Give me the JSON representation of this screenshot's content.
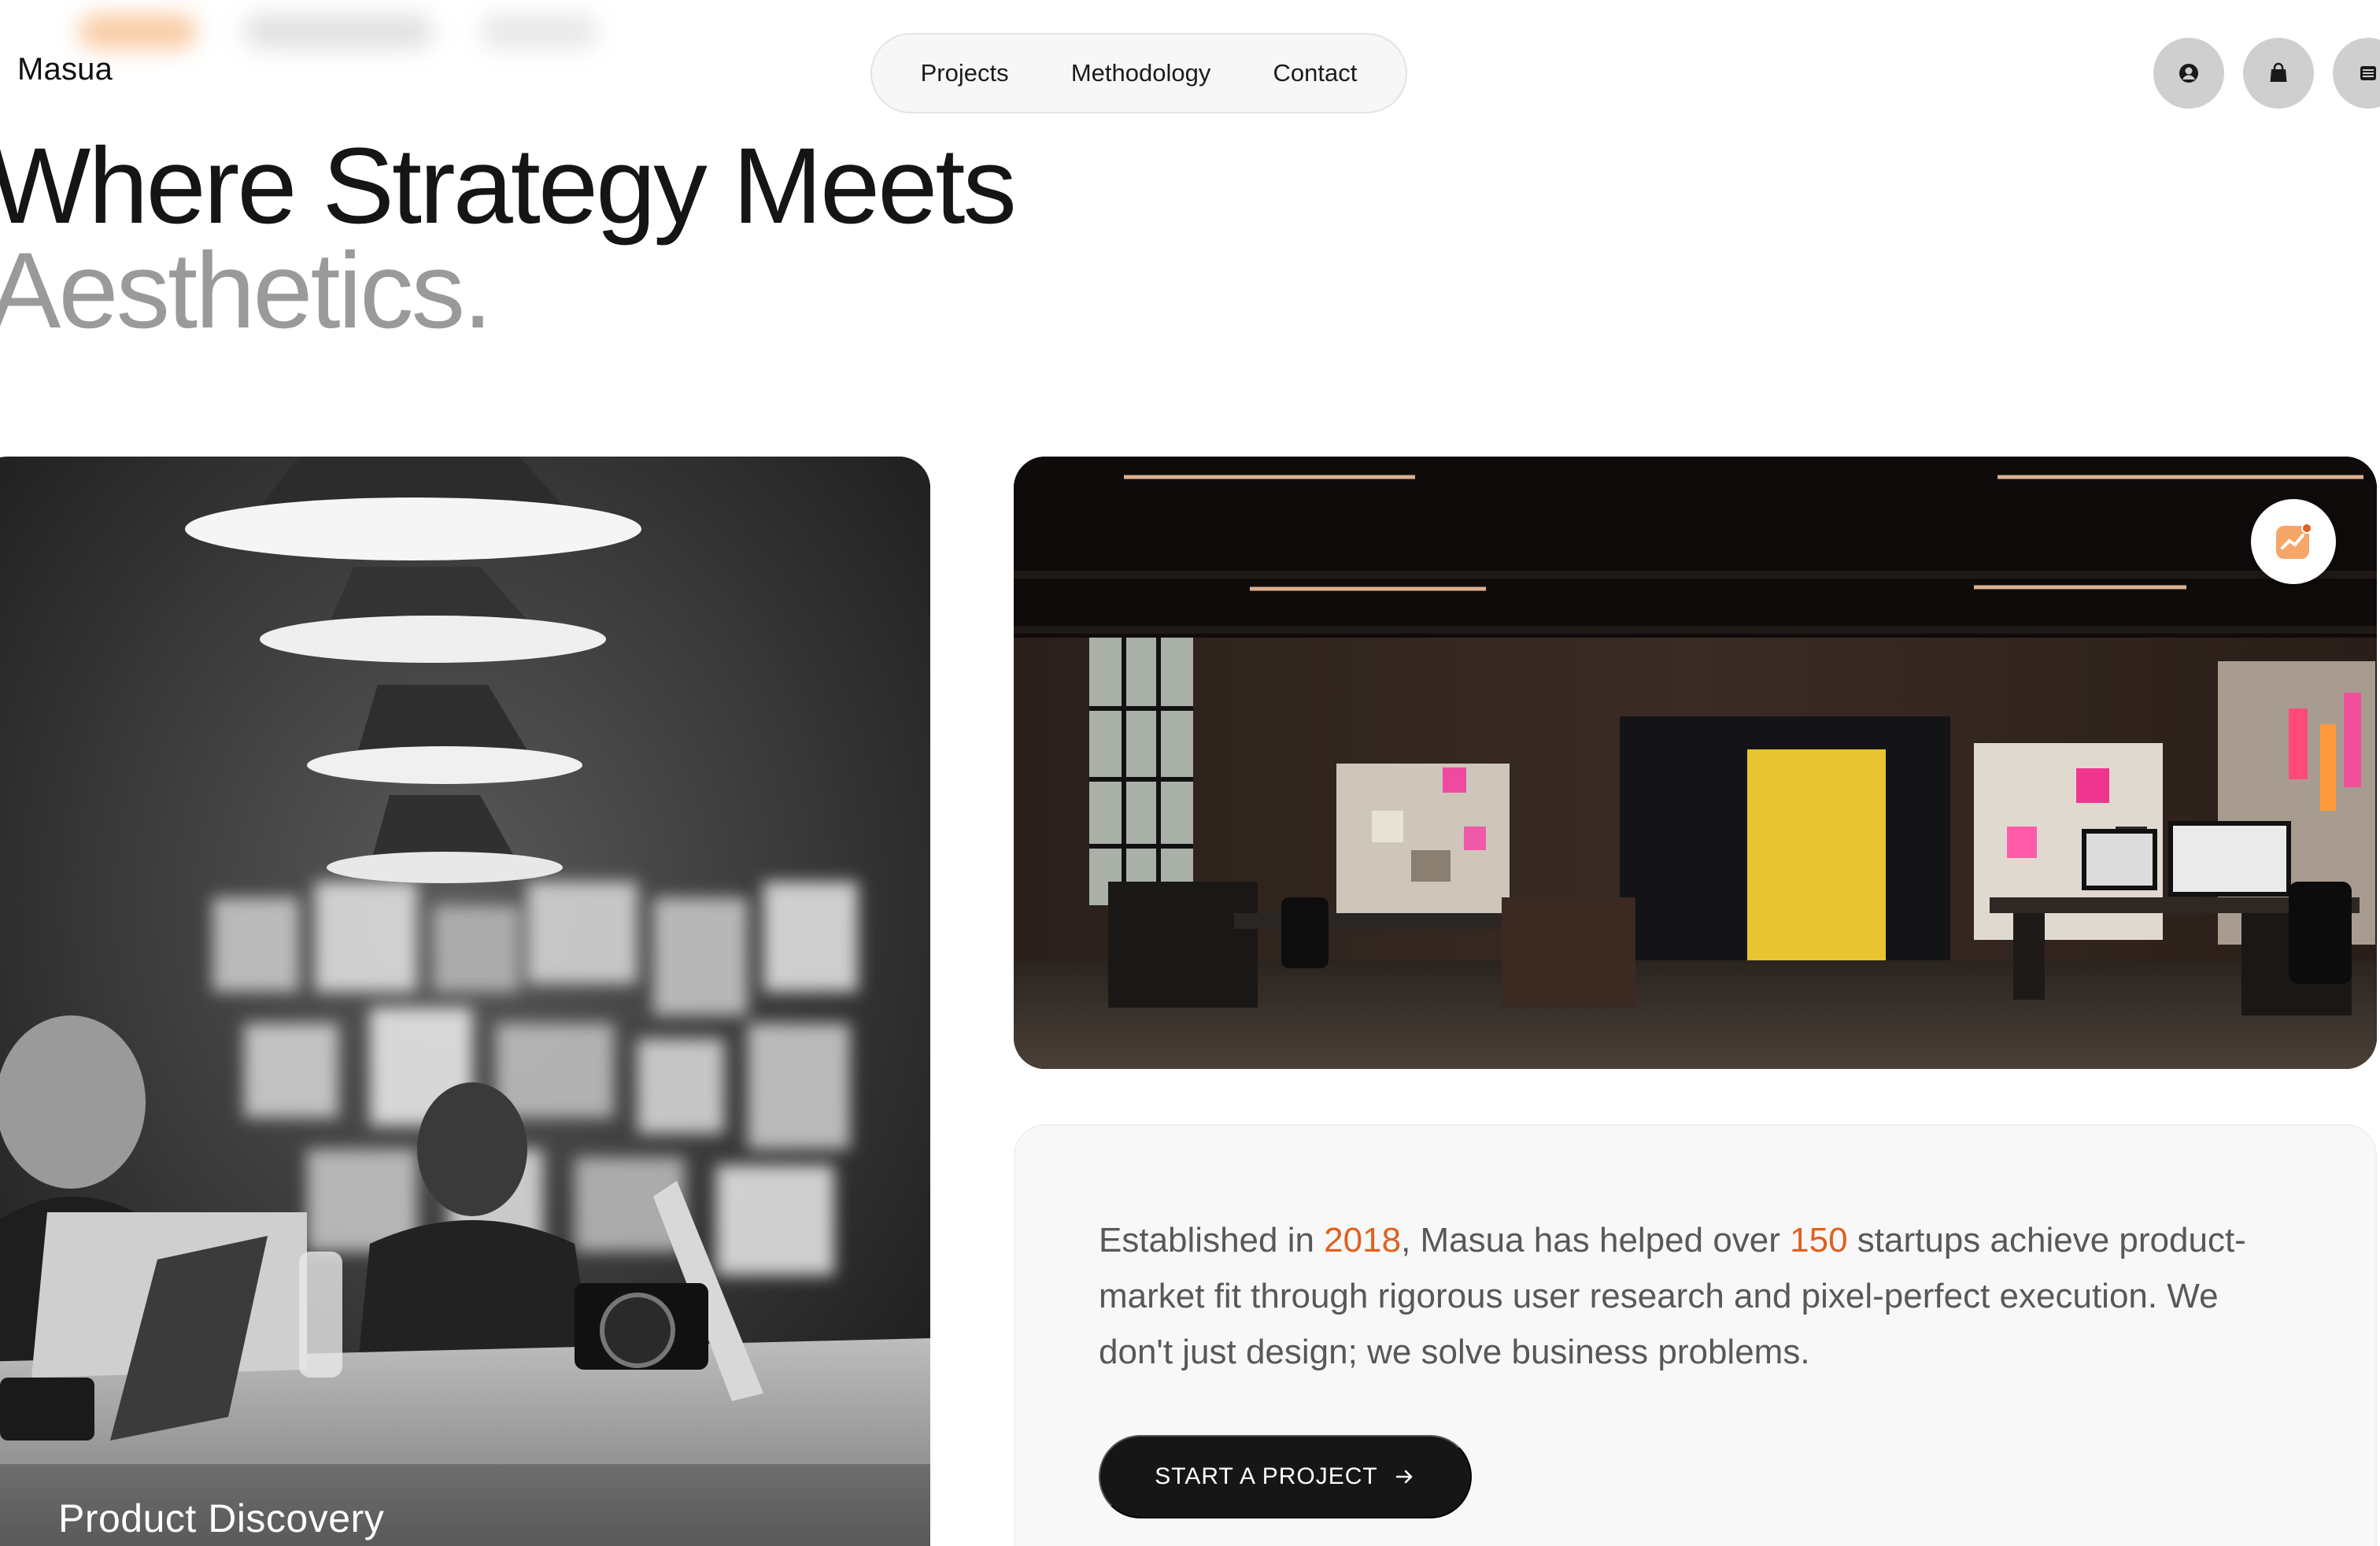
{
  "brand": {
    "name": "Masua",
    "accent": "#e0601e"
  },
  "nav": {
    "items": [
      {
        "label": "Projects"
      },
      {
        "label": "Methodology"
      },
      {
        "label": "Contact"
      }
    ]
  },
  "header_icons": [
    "user-icon",
    "bag-icon",
    "menu-icon"
  ],
  "hero": {
    "line1": "Where Strategy Meets",
    "line2": "Aesthetics."
  },
  "cards": {
    "left_caption": "Product Discovery",
    "right_badge_icon": "trend-icon"
  },
  "about": {
    "part1": "Established in ",
    "year": "2018",
    "part2": ", Masua has helped over ",
    "count": "150",
    "part3": " startups achieve product-market fit through rigorous user research and pixel-perfect execution. We don't just design; we solve business problems."
  },
  "cta": {
    "label": "START A PROJECT",
    "icon": "arrow-right-icon"
  }
}
